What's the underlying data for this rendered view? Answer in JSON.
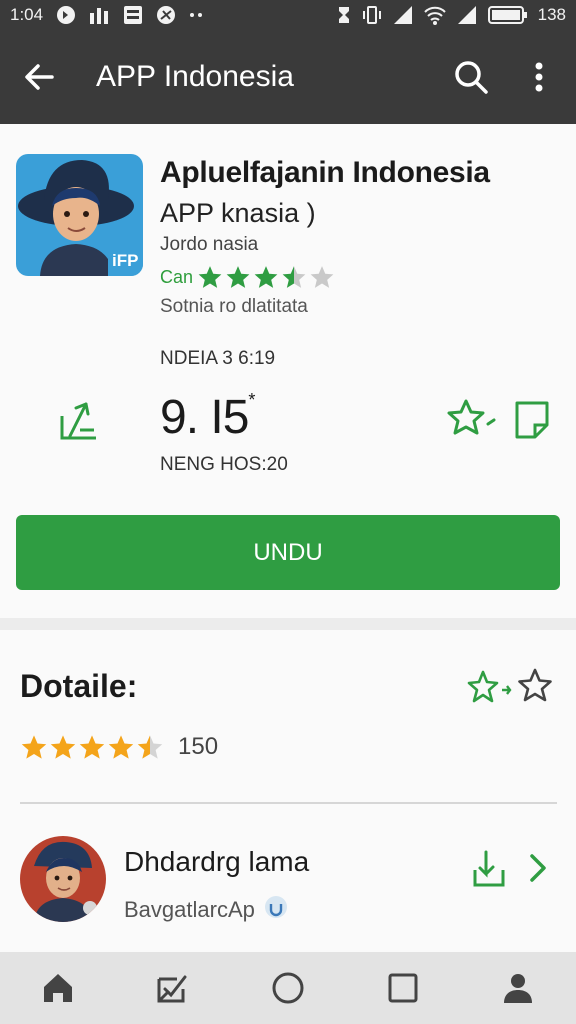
{
  "status_bar": {
    "time": "1:04",
    "battery": "138",
    "left_icons": [
      "notification-icon",
      "bars-app-icon",
      "message-icon",
      "browser-icon",
      "more-dots-icon"
    ],
    "right_icons": [
      "sync-icon",
      "vibrate-icon",
      "signal-icon",
      "wifi-icon",
      "signal-icon",
      "battery-icon"
    ]
  },
  "app_bar": {
    "title": "APP Indonesia",
    "icons": [
      "back-arrow-icon",
      "search-icon",
      "more-vert-icon"
    ]
  },
  "app": {
    "name": "Apluelfajanin Indonesia",
    "subtitle": "APP knasia  )",
    "publisher_line": "Jordo nasia",
    "rating_prefix": "Can",
    "rating_stars": 3.5,
    "meta": "Sotnia ro dlatitata",
    "version": "NDEIA 3 6:19",
    "score": "9. I5",
    "score_mark": "*",
    "size": "NENG HOS:20",
    "install_label": "UNDU",
    "accent_color": "#2f9d42"
  },
  "details": {
    "title": "Dotaile:",
    "stars": 4.5,
    "count": "150",
    "star_color": "#f4a41a"
  },
  "developer": {
    "name": "Dhdardrg lama",
    "sub": "BavgatlarcAp"
  },
  "bottom_nav": [
    "home-icon",
    "inbox-check-icon",
    "circle-icon",
    "square-icon",
    "person-icon"
  ]
}
